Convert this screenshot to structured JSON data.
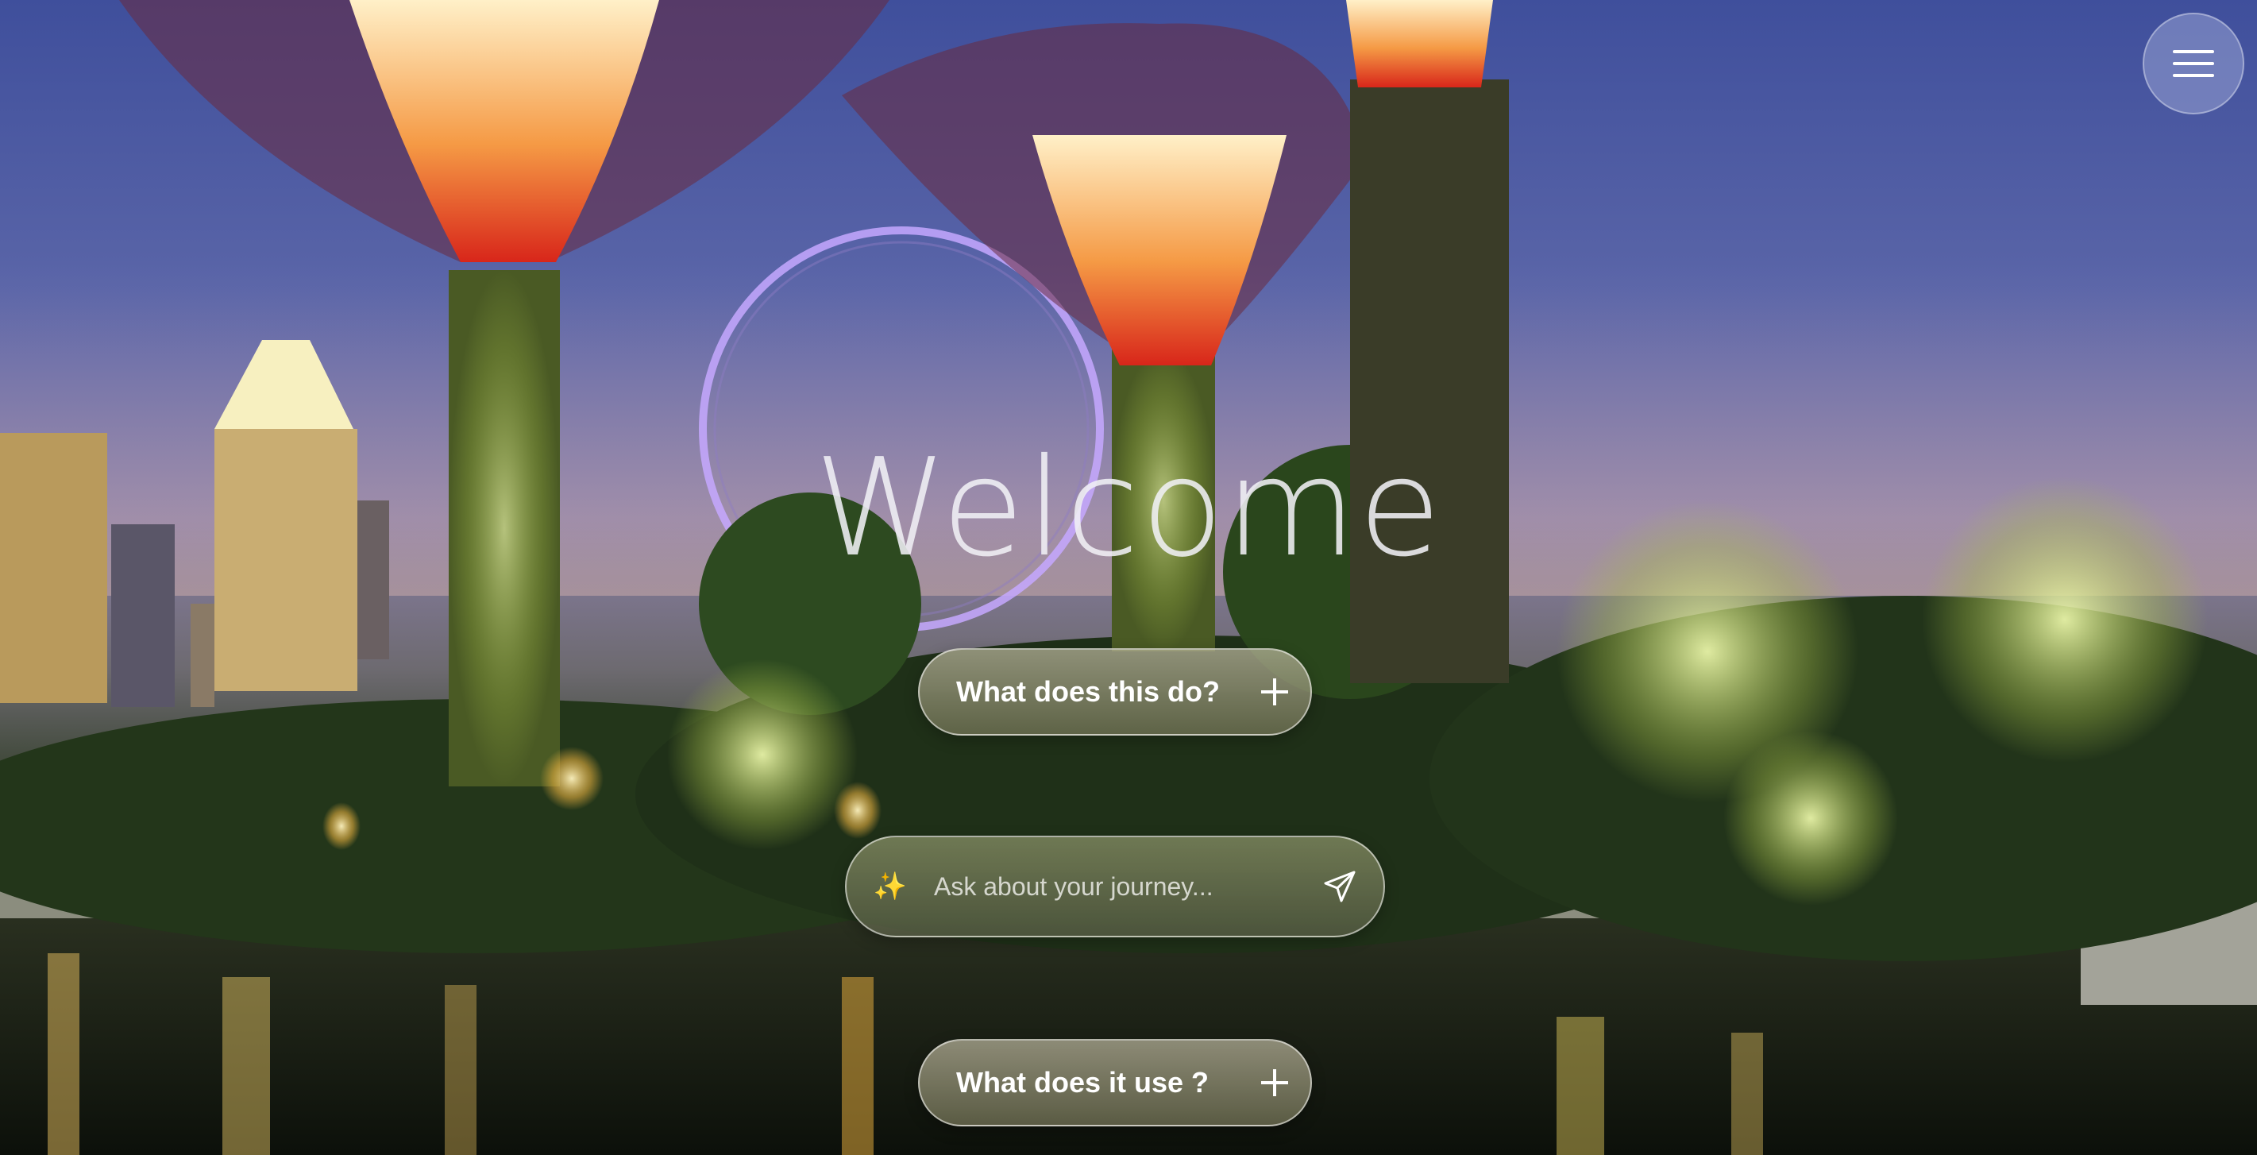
{
  "hero": {
    "title": "Welcome"
  },
  "menu": {
    "icon": "hamburger-menu-icon"
  },
  "faq": [
    {
      "label": "What does this do?",
      "icon": "plus-icon"
    },
    {
      "label": "What does it use ?",
      "icon": "plus-icon"
    }
  ],
  "search": {
    "placeholder": "Ask about your journey...",
    "value": "",
    "leading_icon": "sparkles-icon",
    "send_icon": "send-paper-plane-icon"
  },
  "colors": {
    "sky_top": "#3f4f9c",
    "sky_mid": "#8a7fa7",
    "pill_text": "#ffffff",
    "sparkle": "#f6d46a"
  }
}
